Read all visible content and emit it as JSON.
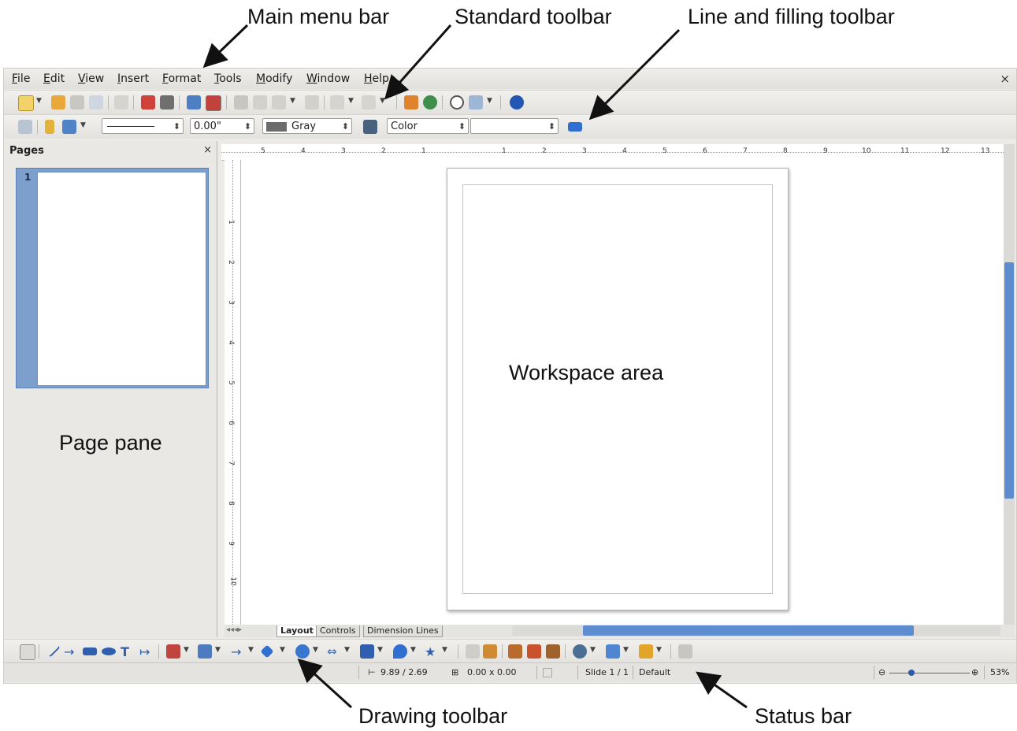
{
  "annotations": {
    "main_menu_bar": "Main menu bar",
    "standard_toolbar": "Standard toolbar",
    "line_filling_toolbar": "Line and filling toolbar",
    "page_pane": "Page pane",
    "workspace_area": "Workspace area",
    "drawing_toolbar": "Drawing toolbar",
    "status_bar": "Status bar"
  },
  "menubar": {
    "items": [
      "File",
      "Edit",
      "View",
      "Insert",
      "Format",
      "Tools",
      "Modify",
      "Window",
      "Help"
    ],
    "close": "×"
  },
  "standard_toolbar": {
    "icons": [
      "new-icon",
      "open-icon",
      "save-icon",
      "email-icon",
      "edit-file-icon",
      "export-pdf-icon",
      "print-icon",
      "spellcheck-icon",
      "autospell-icon",
      "cut-icon",
      "copy-icon",
      "paste-icon",
      "clone-format-icon",
      "undo-icon",
      "redo-icon",
      "chart-icon",
      "navigator-icon",
      "hide-draw-functions-icon",
      "zoom-icon",
      "help-icon"
    ]
  },
  "line_filling_toolbar": {
    "line_width": "0.00\"",
    "line_color": "Gray",
    "line_color_hex": "#6b6b6b",
    "area_style": "Color",
    "area_value": ""
  },
  "pages_pane": {
    "title": "Pages",
    "close": "×",
    "thumbnail_number": "1"
  },
  "ruler": {
    "h_labels": [
      "5",
      "4",
      "3",
      "2",
      "1",
      "1",
      "2",
      "3",
      "4",
      "5",
      "6",
      "7",
      "8",
      "9",
      "10",
      "11",
      "12",
      "13"
    ],
    "v_labels": [
      "1",
      "2",
      "3",
      "4",
      "5",
      "6",
      "7",
      "8",
      "9",
      "10"
    ]
  },
  "tabs": {
    "items": [
      "Layout",
      "Controls",
      "Dimension Lines"
    ],
    "active": "Layout"
  },
  "statusbar": {
    "position": "9.89 / 2.69",
    "size": "0.00 x 0.00",
    "slide": "Slide 1 / 1",
    "layout": "Default",
    "zoom": "53%"
  },
  "colors": {
    "accent": "#5e8dcf",
    "pane_highlight": "#7c9fcd"
  }
}
